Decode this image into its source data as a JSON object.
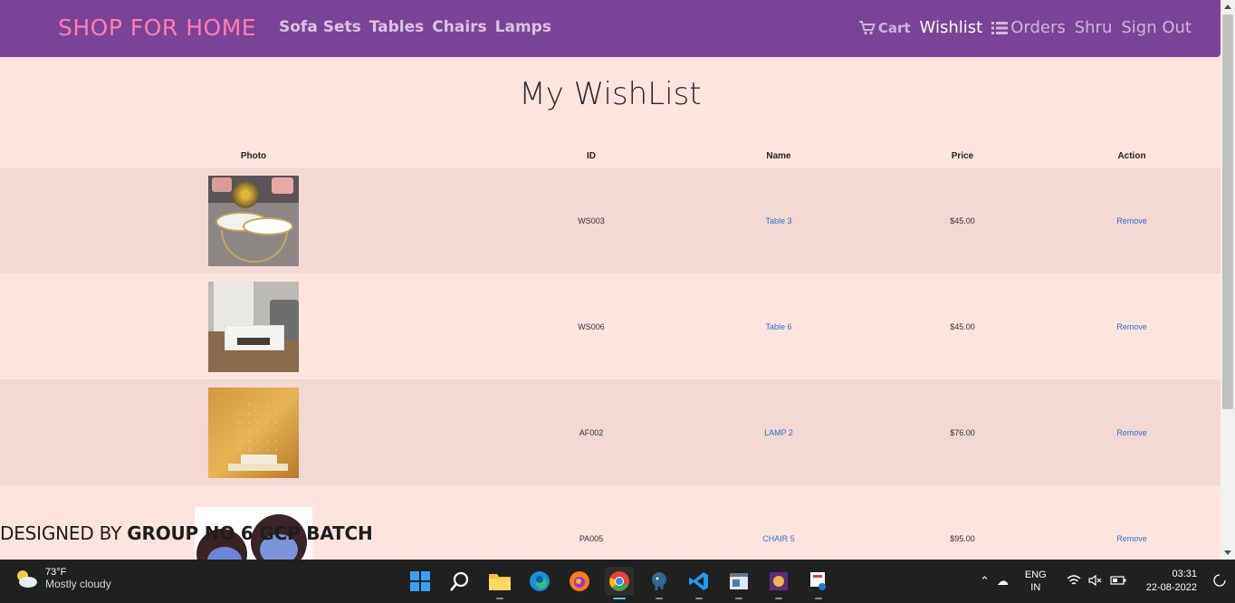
{
  "navbar": {
    "brand": "SHOP FOR HOME",
    "left_links": [
      "Sofa Sets",
      "Tables",
      "Chairs",
      "Lamps"
    ],
    "cart": "Cart",
    "wishlist": "Wishlist",
    "orders": "Orders",
    "user": "Shru",
    "signout": "Sign Out"
  },
  "page_title": "My WishList",
  "table": {
    "headers": [
      "Photo",
      "ID",
      "Name",
      "Price",
      "Action"
    ],
    "rows": [
      {
        "id": "WS003",
        "name": "Table 3",
        "price": "$45.00",
        "action": "Remove"
      },
      {
        "id": "WS006",
        "name": "Table 6",
        "price": "$45.00",
        "action": "Remove"
      },
      {
        "id": "AF002",
        "name": "LAMP 2",
        "price": "$76.00",
        "action": "Remove"
      },
      {
        "id": "PA005",
        "name": "CHAIR 5",
        "price": "$95.00",
        "action": "Remove"
      }
    ]
  },
  "footer": {
    "prefix": "DESIGNED BY ",
    "bold": "GROUP NO 6 GCP BATCH"
  },
  "taskbar": {
    "temperature": "73°F",
    "weather": "Mostly cloudy",
    "language": "ENG",
    "region": "IN",
    "time": "03:31",
    "date": "22-08-2022"
  },
  "colors": {
    "navbar_bg": "#7b4397",
    "brand": "#ff7eb0",
    "page_bg": "#ffe4de",
    "row_alt": "#f3d8d3",
    "link": "#2f6fd6"
  }
}
